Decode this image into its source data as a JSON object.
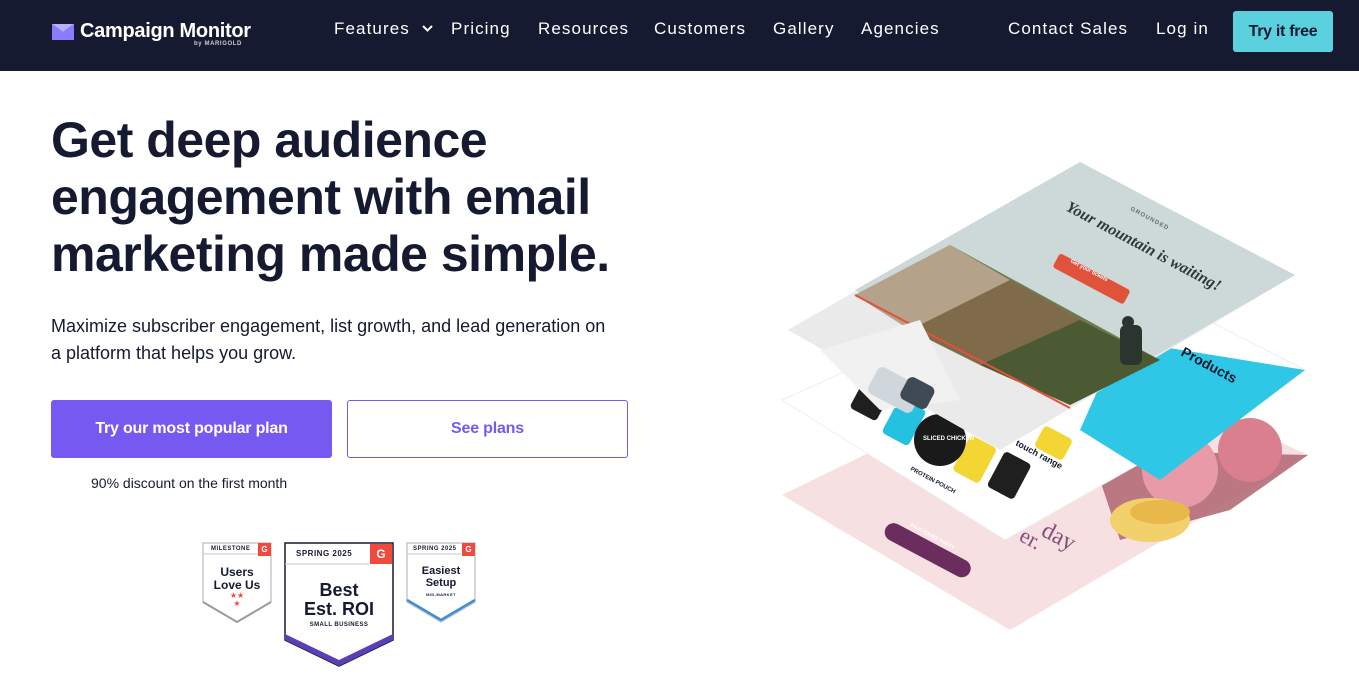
{
  "nav": {
    "logo_text": "Campaign Monitor",
    "logo_sub": "by MARIGOLD",
    "links": [
      "Features",
      "Pricing",
      "Resources",
      "Customers",
      "Gallery",
      "Agencies"
    ],
    "contact_sales": "Contact Sales",
    "login": "Log in",
    "try_free": "Try it free"
  },
  "hero": {
    "headline_1": "Get deep audience",
    "headline_2": "engagement with email",
    "headline_3": "marketing made simple.",
    "subhead_1": "Maximize subscriber engagement, list growth, and lead generation on",
    "subhead_2": "a platform that helps you grow.",
    "primary_cta": "Try our most popular plan",
    "secondary_cta": "See plans",
    "discount_note": "90% discount on the first month"
  },
  "badges": [
    {
      "top": "MILESTONE",
      "line1": "Users",
      "line2": "Love Us",
      "sub": ""
    },
    {
      "top": "SPRING 2025",
      "line1": "Best",
      "line2": "Est. ROI",
      "sub": "SMALL BUSINESS"
    },
    {
      "top": "SPRING 2025",
      "line1": "Easiest",
      "line2": "Setup",
      "sub": "MID-MARKET"
    }
  ],
  "illustration": {
    "card1_brand": "GROUNDED",
    "card1_title": "Your mountain is waiting!",
    "card1_cta": "Get your tickets",
    "card2_title": "Products",
    "card2_label1": "SLICED CHICKEN",
    "card2_label2": "PROTEIN POUCH",
    "card2_text": "touch range",
    "card3_text": "day",
    "card3_text2": "er.",
    "card3_cta": "PICK YOURS TODAY"
  },
  "colors": {
    "nav_bg": "#151a31",
    "accent_purple": "#7559f1",
    "accent_teal": "#5bd0de",
    "g2_red": "#f0493e"
  }
}
